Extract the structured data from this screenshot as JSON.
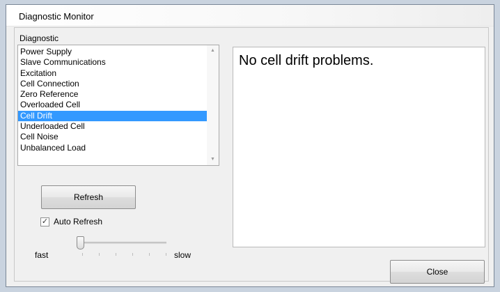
{
  "window": {
    "title": "Diagnostic Monitor"
  },
  "diagnostic": {
    "label": "Diagnostic",
    "items": [
      {
        "label": "Power Supply",
        "selected": false
      },
      {
        "label": "Slave Communications",
        "selected": false
      },
      {
        "label": "Excitation",
        "selected": false
      },
      {
        "label": "Cell Connection",
        "selected": false
      },
      {
        "label": "Zero Reference",
        "selected": false
      },
      {
        "label": "Overloaded Cell",
        "selected": false
      },
      {
        "label": "Cell Drift",
        "selected": true
      },
      {
        "label": "Underloaded Cell",
        "selected": false
      },
      {
        "label": "Cell Noise",
        "selected": false
      },
      {
        "label": "Unbalanced Load",
        "selected": false
      }
    ]
  },
  "message": {
    "text": "No cell drift problems."
  },
  "controls": {
    "refresh_label": "Refresh",
    "auto_refresh_label": "Auto Refresh",
    "auto_refresh_checked": true,
    "slider": {
      "min_label": "fast",
      "max_label": "slow",
      "value": 0
    },
    "close_label": "Close"
  },
  "colors": {
    "selection": "#3399ff"
  }
}
